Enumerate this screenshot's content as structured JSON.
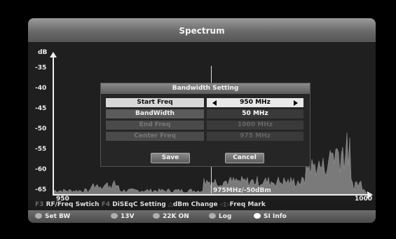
{
  "title": "Spectrum",
  "y_axis": {
    "unit": "dB",
    "ticks": [
      "-35",
      "-40",
      "-45",
      "-50",
      "-55",
      "-60",
      "-65"
    ]
  },
  "x_axis": {
    "start": "950",
    "end": "1000",
    "marker_readout": "975MHz/-50dBm"
  },
  "dialog": {
    "title": "Bandwidth Setting",
    "rows": [
      {
        "label": "Start Freq",
        "value": "950 MHz",
        "state": "active"
      },
      {
        "label": "BandWidth",
        "value": "50 MHz",
        "state": "normal"
      },
      {
        "label": "End Freq",
        "value": "1000 MHz",
        "state": "disabled"
      },
      {
        "label": "Center Freq",
        "value": "975 MHz",
        "state": "disabled"
      }
    ],
    "save_label": "Save",
    "cancel_label": "Cancel"
  },
  "help": {
    "f3_key": "F3",
    "f3_text": "RF/Freq Swtich",
    "f4_key": "F4",
    "f4_text": "DiSEqC Setting",
    "dbm_text": "dBm Change",
    "freq_text": "Freq Mark"
  },
  "legend": [
    {
      "label": "Set BW",
      "color": "#b0b0b0"
    },
    {
      "label": "13V",
      "color": "#b0b0b0"
    },
    {
      "label": "22K ON",
      "color": "#b0b0b0"
    },
    {
      "label": "Log",
      "color": "#b0b0b0"
    },
    {
      "label": "SI Info",
      "color": "#ffffff"
    }
  ],
  "colors": {
    "background": "#1b1b1b",
    "title_bar": "#7a7a7a",
    "spectrum_fill": "#7a7a7a"
  }
}
